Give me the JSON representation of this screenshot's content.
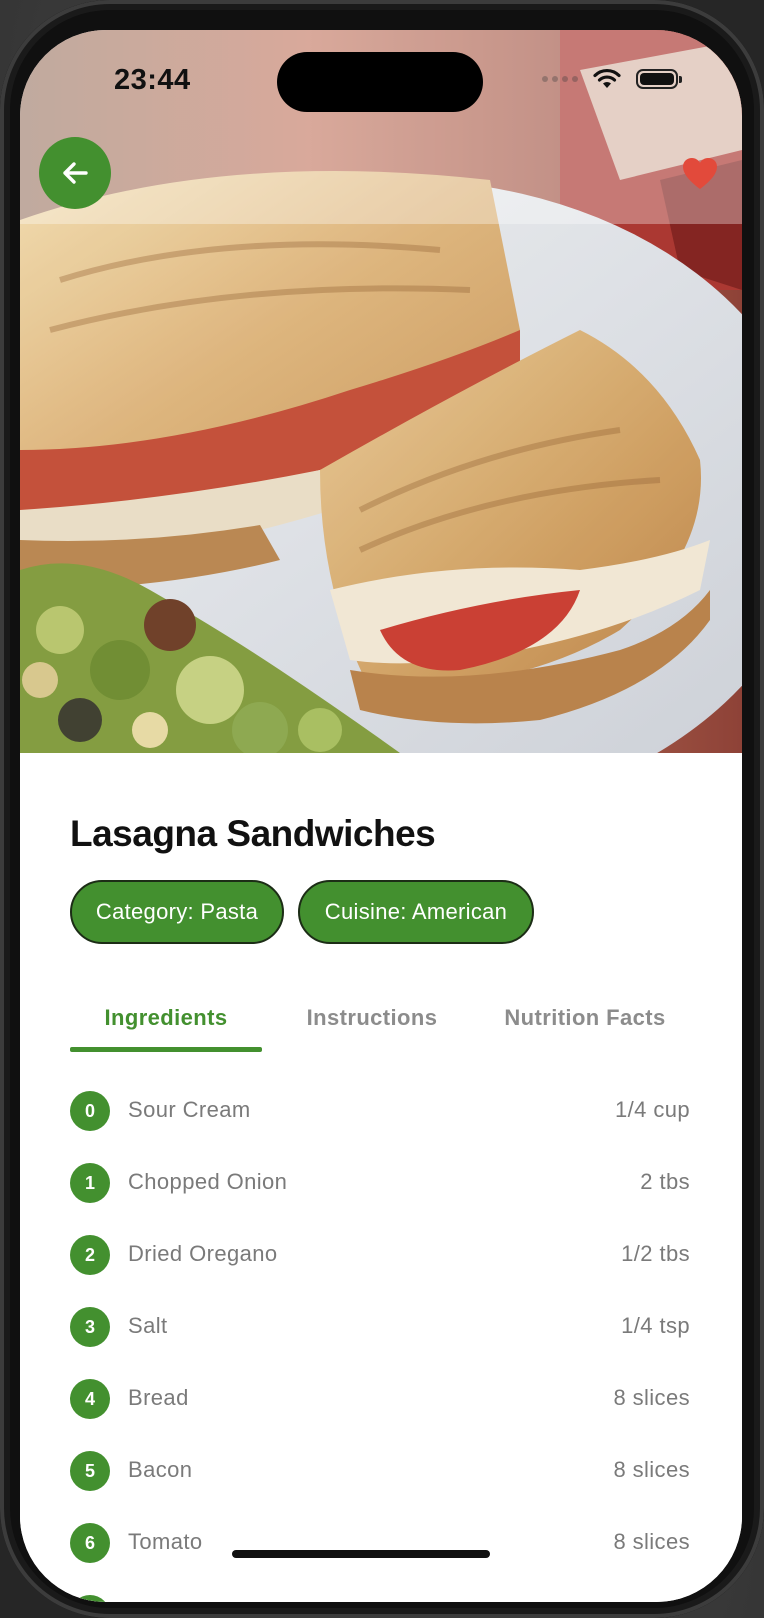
{
  "status_bar": {
    "time": "23:44"
  },
  "header": {
    "back_icon": "arrow-left-icon",
    "favorite_icon": "heart-icon",
    "favorite_color": "#e24a3b"
  },
  "hero_image": {
    "description_icon": "sandwich-photo"
  },
  "recipe": {
    "title": "Lasagna Sandwiches",
    "chips": [
      "Category: Pasta",
      "Cuisine: American"
    ]
  },
  "tabs": [
    {
      "label": "Ingredients",
      "active": true
    },
    {
      "label": "Instructions",
      "active": false
    },
    {
      "label": "Nutrition Facts",
      "active": false
    }
  ],
  "ingredients": [
    {
      "index": "0",
      "name": "Sour Cream",
      "qty": "1/4 cup"
    },
    {
      "index": "1",
      "name": "Chopped Onion",
      "qty": "2 tbs"
    },
    {
      "index": "2",
      "name": "Dried Oregano",
      "qty": "1/2 tbs"
    },
    {
      "index": "3",
      "name": "Salt",
      "qty": "1/4 tsp"
    },
    {
      "index": "4",
      "name": "Bread",
      "qty": "8 slices"
    },
    {
      "index": "5",
      "name": "Bacon",
      "qty": "8 slices"
    },
    {
      "index": "6",
      "name": "Tomato",
      "qty": "8 slices"
    }
  ],
  "colors": {
    "accent": "#43902f",
    "muted_text": "#7a7a7a",
    "tab_inactive": "#8c8c8c",
    "heart": "#e24a3b"
  }
}
